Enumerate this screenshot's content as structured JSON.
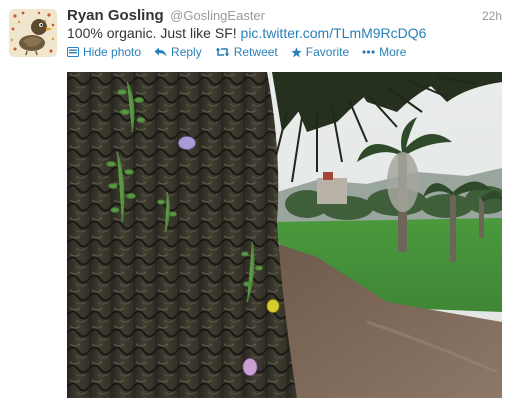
{
  "tweet": {
    "author_name": "Ryan Gosling",
    "author_handle": "@GoslingEaster",
    "timestamp": "22h",
    "text": "100% organic. Just like SF!",
    "link": "pic.twitter.com/TLmM9RcDQ6"
  },
  "actions": {
    "hide_photo": "Hide photo",
    "reply": "Reply",
    "retweet": "Retweet",
    "favorite": "Favorite",
    "more": "More"
  },
  "icons": {
    "hide_photo": "photo-icon",
    "reply": "reply-arrow-icon",
    "retweet": "retweet-arrows-icon",
    "favorite": "star-icon",
    "more": "ellipsis-icon"
  },
  "colors": {
    "link": "#2a80b9",
    "name": "#333333",
    "muted": "#999999"
  }
}
